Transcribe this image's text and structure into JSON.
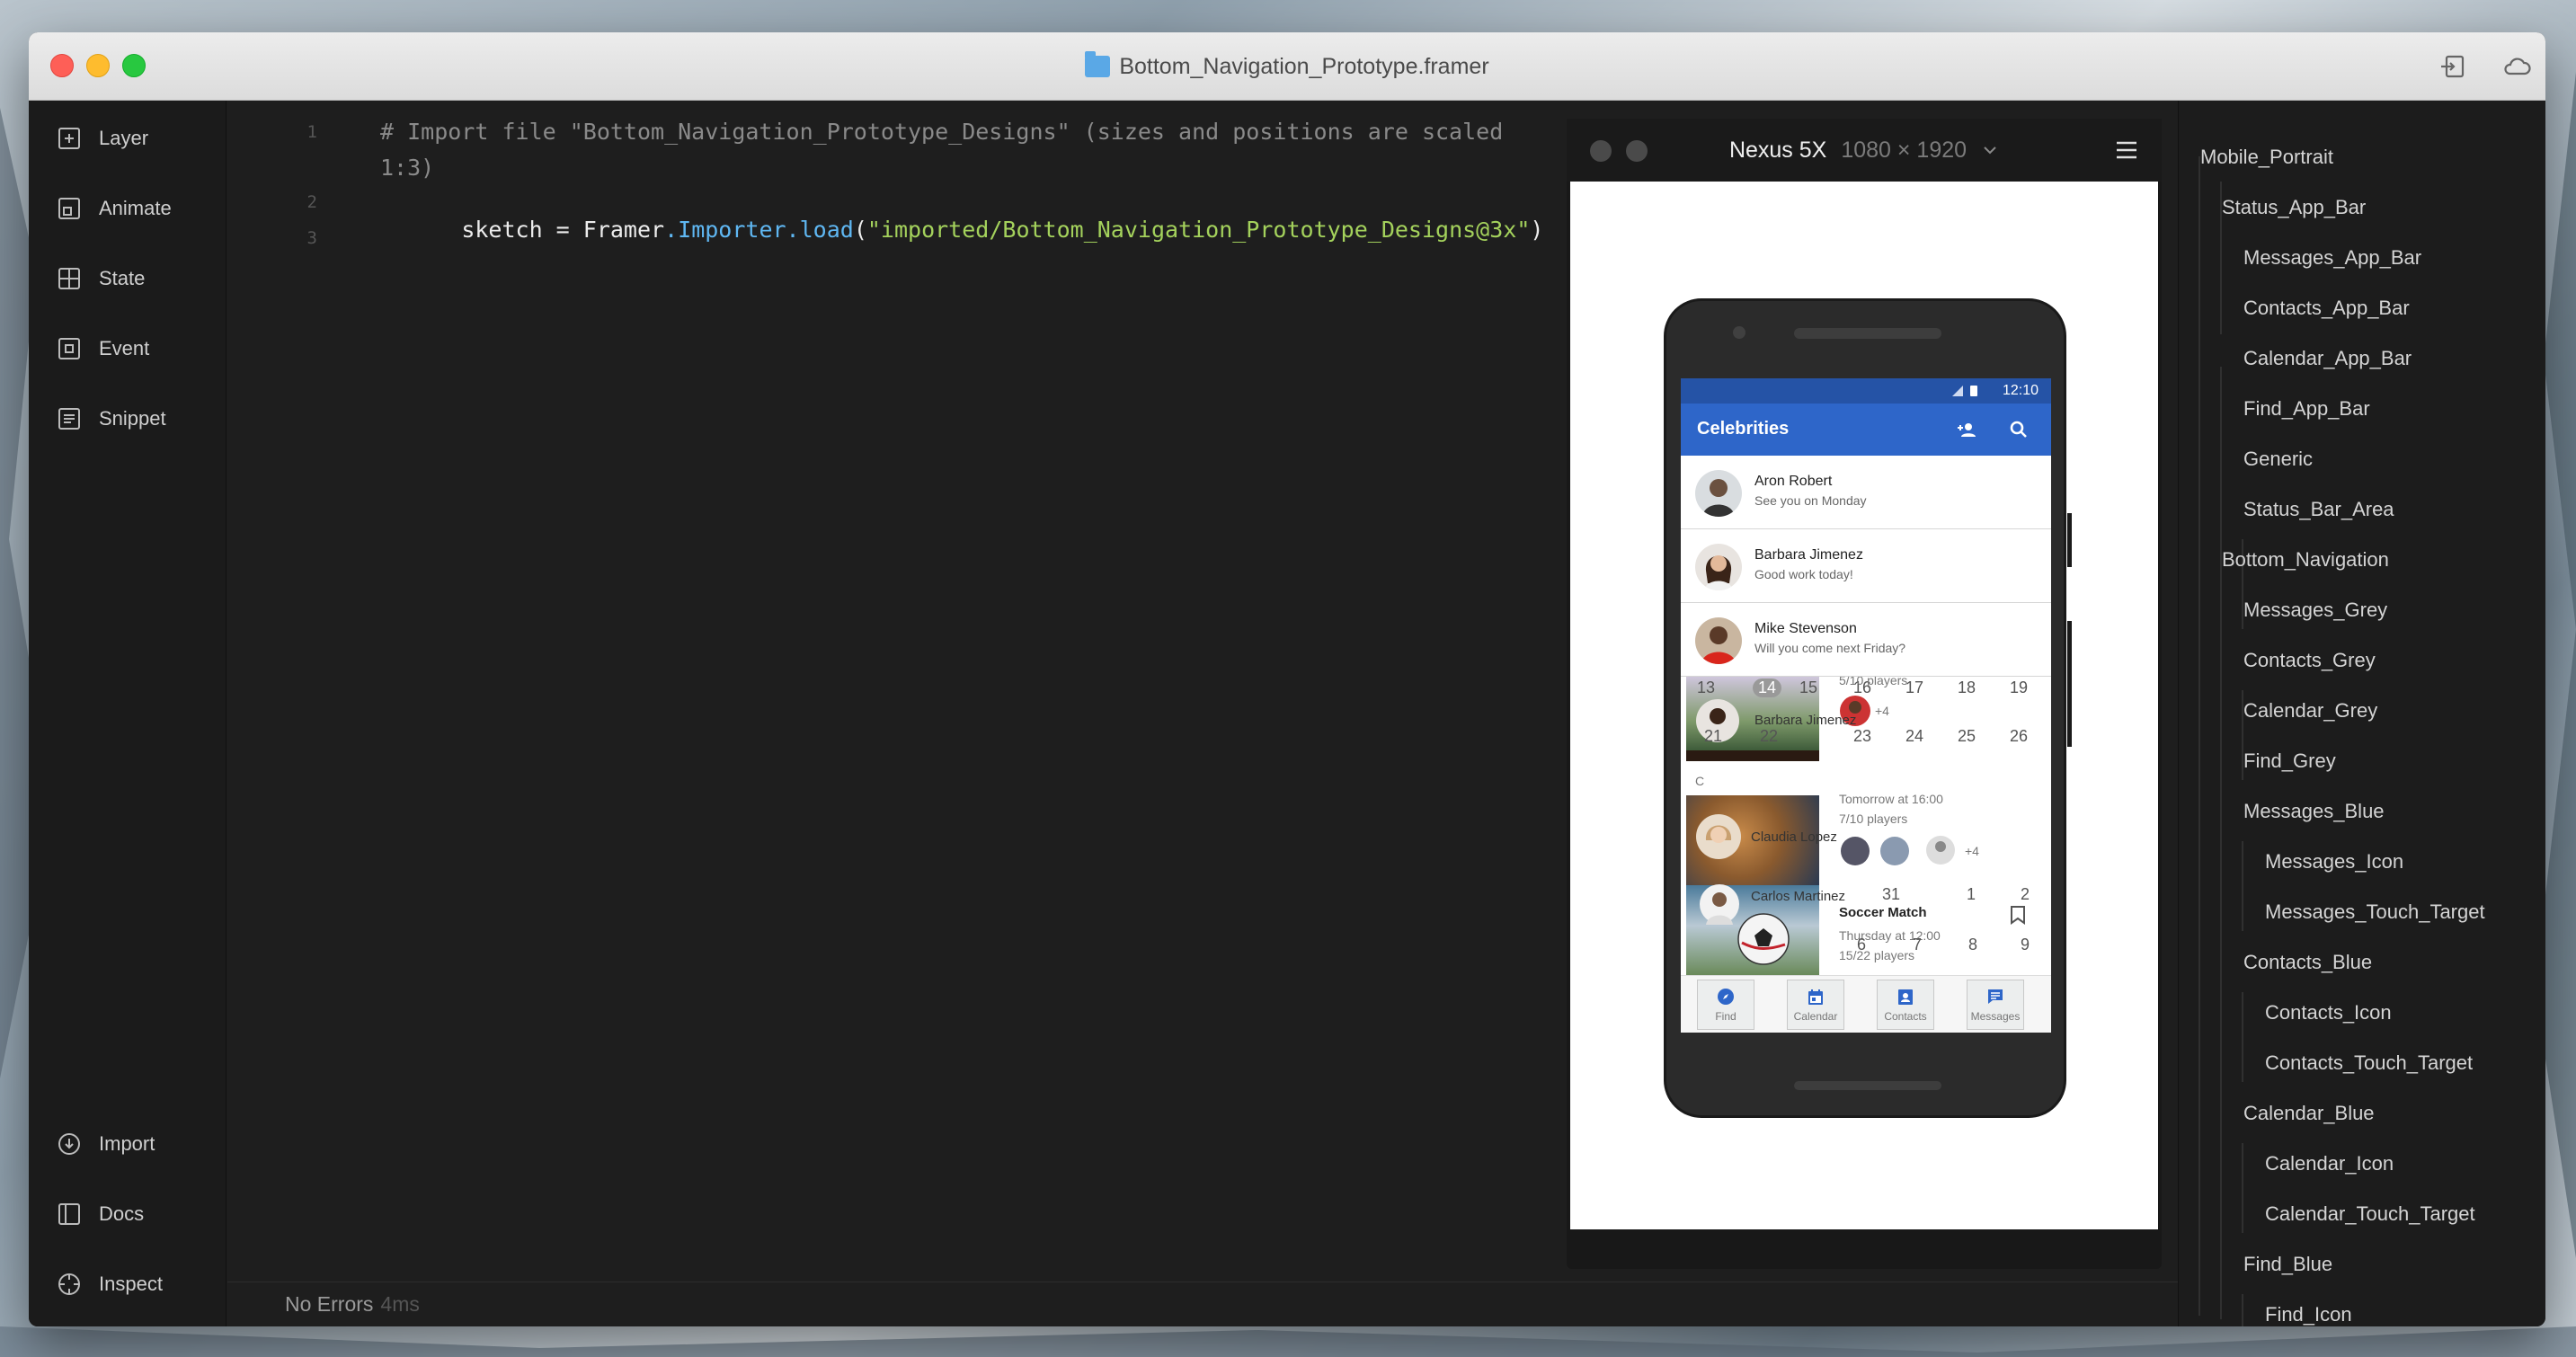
{
  "window": {
    "title": "Bottom_Navigation_Prototype.framer"
  },
  "sidebar": {
    "items": [
      {
        "label": "Layer",
        "icon": "layer-plus-icon"
      },
      {
        "label": "Animate",
        "icon": "animate-icon"
      },
      {
        "label": "State",
        "icon": "state-grid-icon"
      },
      {
        "label": "Event",
        "icon": "event-icon"
      },
      {
        "label": "Snippet",
        "icon": "snippet-icon"
      }
    ],
    "bottom_items": [
      {
        "label": "Import",
        "icon": "import-icon"
      },
      {
        "label": "Docs",
        "icon": "docs-icon"
      },
      {
        "label": "Inspect",
        "icon": "inspect-crosshair-icon"
      }
    ]
  },
  "editor": {
    "line_numbers": [
      "1",
      "2",
      "3"
    ],
    "line1a": "# Import file \"Bottom_Navigation_Prototype_Designs\" (sizes and positions are scaled",
    "line1b": "1:3)",
    "line2": {
      "t1": "sketch = Framer",
      "t2": ".Importer.load",
      "t3": "(",
      "t4": "\"imported/Bottom_Navigation_Prototype_Designs@3x\"",
      "t5": ")"
    }
  },
  "status": {
    "message": "No Errors",
    "time": "4ms"
  },
  "preview": {
    "device_name": "Nexus 5X",
    "device_resolution": "1080 × 1920",
    "phone": {
      "time": "12:10",
      "appbar_title": "Celebrities",
      "contacts": [
        {
          "name": "Aron Robert",
          "message": "See you on Monday"
        },
        {
          "name": "Barbara Jimenez",
          "message": "Good work today!"
        },
        {
          "name": "Mike Stevenson",
          "message": "Will you come next Friday?"
        }
      ],
      "overlap": {
        "cal_row1": [
          "13",
          "14",
          "15",
          "16",
          "17",
          "18",
          "19"
        ],
        "cal_row2": [
          "21",
          "22",
          "23",
          "24",
          "25",
          "26"
        ],
        "players1": "5/10 players",
        "plus1": "+4",
        "name1": "Barbara Jimenez",
        "letter": "C",
        "time2": "Tomorrow at 16:00",
        "players2": "7/10 players",
        "name2": "Claudia Lopez",
        "plus2": "+4",
        "name3": "Carlos Martinez",
        "cal_31": "31",
        "cal_1": "1",
        "cal_2": "2",
        "event_title": "Soccer Match",
        "event_time": "Thursday at 12:00",
        "players3": "15/22 players",
        "cal_6": "6",
        "cal_7": "7",
        "cal_8": "8",
        "cal_9": "9"
      },
      "nav": [
        {
          "label": "Find",
          "icon": "compass-icon"
        },
        {
          "label": "Calendar",
          "icon": "calendar-icon"
        },
        {
          "label": "Contacts",
          "icon": "contacts-icon"
        },
        {
          "label": "Messages",
          "icon": "messages-icon"
        }
      ],
      "accent": "#2e66c9"
    }
  },
  "layers": {
    "items": [
      {
        "label": "Mobile_Portrait",
        "depth": 0
      },
      {
        "label": "Status_App_Bar",
        "depth": 1
      },
      {
        "label": "Messages_App_Bar",
        "depth": 2
      },
      {
        "label": "Contacts_App_Bar",
        "depth": 2
      },
      {
        "label": "Calendar_App_Bar",
        "depth": 2
      },
      {
        "label": "Find_App_Bar",
        "depth": 2
      },
      {
        "label": "Generic",
        "depth": 2
      },
      {
        "label": "Status_Bar_Area",
        "depth": 2
      },
      {
        "label": "Bottom_Navigation",
        "depth": 1
      },
      {
        "label": "Messages_Grey",
        "depth": 2
      },
      {
        "label": "Contacts_Grey",
        "depth": 2
      },
      {
        "label": "Calendar_Grey",
        "depth": 2
      },
      {
        "label": "Find_Grey",
        "depth": 2
      },
      {
        "label": "Messages_Blue",
        "depth": 2
      },
      {
        "label": "Messages_Icon",
        "depth": 3
      },
      {
        "label": "Messages_Touch_Target",
        "depth": 3
      },
      {
        "label": "Contacts_Blue",
        "depth": 2
      },
      {
        "label": "Contacts_Icon",
        "depth": 3
      },
      {
        "label": "Contacts_Touch_Target",
        "depth": 3
      },
      {
        "label": "Calendar_Blue",
        "depth": 2
      },
      {
        "label": "Calendar_Icon",
        "depth": 3
      },
      {
        "label": "Calendar_Touch_Target",
        "depth": 3
      },
      {
        "label": "Find_Blue",
        "depth": 2
      },
      {
        "label": "Find_Icon",
        "depth": 3
      }
    ]
  }
}
